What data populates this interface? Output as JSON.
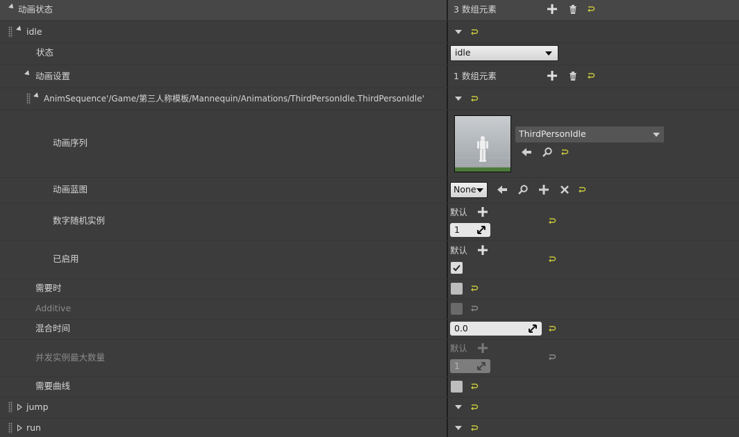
{
  "header": {
    "title": "动画状态",
    "array_count": "3 数组元素"
  },
  "idle": {
    "label": "idle",
    "state_label": "状态",
    "state_value": "idle",
    "anim_settings_label": "动画设置",
    "anim_settings_count": "1 数组元素",
    "asset_path": "AnimSequence'/Game/第三人称模板/Mannequin/Animations/ThirdPersonIdle.ThirdPersonIdle'",
    "anim_sequence_label": "动画序列",
    "anim_sequence_value": "ThirdPersonIdle",
    "anim_blueprint_label": "动画蓝图",
    "anim_blueprint_value": "None",
    "random_instances_label": "数字随机实例",
    "random_default_label": "默认",
    "random_instances_value": "1",
    "enabled_label": "已启用",
    "enabled_default_label": "默认",
    "on_demand_label": "需要时",
    "additive_label": "Additive",
    "blend_time_label": "混合时间",
    "blend_time_value": "0.0",
    "max_concurrent_label": "并发实例最大数量",
    "max_concurrent_default_label": "默认",
    "max_concurrent_value": "1",
    "requires_curves_label": "需要曲线"
  },
  "jump": {
    "label": "jump"
  },
  "run": {
    "label": "run"
  },
  "colors": {
    "reset_arrow": "#c8c83c",
    "reset_arrow_dim": "#8a8a8a"
  }
}
